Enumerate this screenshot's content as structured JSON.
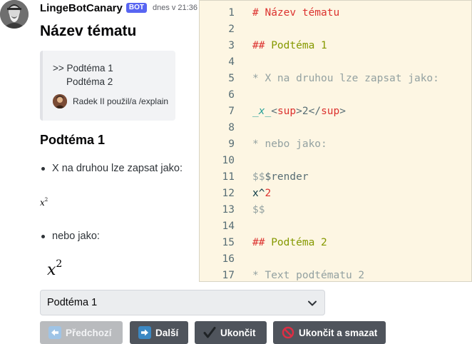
{
  "message": {
    "author": "LingeBotCanary",
    "bot_tag": "BOT",
    "timestamp": "dnes v 21:36"
  },
  "embed": {
    "title": "Název tématu",
    "reply": {
      "line1": ">> Podtéma 1",
      "line2": "Podtéma 2",
      "user_text": "Radek II použil/a /explain"
    },
    "section_heading": "Podtéma 1",
    "bullets": [
      "X na druhou lze zapsat jako:",
      "nebo jako:"
    ],
    "math_inline": {
      "base": "x",
      "exp": "2"
    },
    "math_rendered": {
      "base": "x",
      "exp": "2"
    }
  },
  "code_panel": {
    "lines": [
      {
        "n": "1",
        "parts": [
          {
            "t": "# Název tématu",
            "c": "c-heading"
          }
        ]
      },
      {
        "n": "2",
        "parts": []
      },
      {
        "n": "3",
        "parts": [
          {
            "t": "## ",
            "c": "c-heading"
          },
          {
            "t": "Podtéma 1",
            "c": "c-heading2"
          }
        ]
      },
      {
        "n": "4",
        "parts": []
      },
      {
        "n": "5",
        "parts": [
          {
            "t": "* X na druhou lze zapsat jako:",
            "c": "c-gray"
          }
        ]
      },
      {
        "n": "6",
        "parts": []
      },
      {
        "n": "7",
        "parts": [
          {
            "t": "_x_",
            "c": "c-italic"
          },
          {
            "t": "<",
            "c": "c-plain"
          },
          {
            "t": "sup",
            "c": "c-tag"
          },
          {
            "t": ">2</",
            "c": "c-plain"
          },
          {
            "t": "sup",
            "c": "c-tag"
          },
          {
            "t": ">",
            "c": "c-plain"
          }
        ]
      },
      {
        "n": "8",
        "parts": []
      },
      {
        "n": "9",
        "parts": [
          {
            "t": "* nebo jako:",
            "c": "c-gray"
          }
        ]
      },
      {
        "n": "10",
        "parts": []
      },
      {
        "n": "11",
        "parts": [
          {
            "t": "$$",
            "c": "c-gray"
          },
          {
            "t": "$render",
            "c": "c-plain"
          }
        ]
      },
      {
        "n": "12",
        "parts": [
          {
            "t": "x^",
            "c": "c-dark"
          },
          {
            "t": "2",
            "c": "c-tag"
          }
        ]
      },
      {
        "n": "13",
        "parts": [
          {
            "t": "$$",
            "c": "c-gray"
          }
        ]
      },
      {
        "n": "14",
        "parts": []
      },
      {
        "n": "15",
        "parts": [
          {
            "t": "## ",
            "c": "c-heading"
          },
          {
            "t": "Podtéma 2",
            "c": "c-heading2"
          }
        ]
      },
      {
        "n": "16",
        "parts": []
      },
      {
        "n": "17",
        "parts": [
          {
            "t": "* Text podtématu 2",
            "c": "c-gray"
          }
        ]
      }
    ]
  },
  "select": {
    "value": "Podtéma 1"
  },
  "buttons": {
    "prev": "Předchozí",
    "next": "Další",
    "finish": "Ukončit",
    "finish_delete": "Ukončit a smazat"
  },
  "colors": {
    "accent": "#5865f2",
    "code_background": "#fdf6e3",
    "button_gray": "#4f545c",
    "button_disabled": "#b9bbbe",
    "arrow_blue": "#3b88c3",
    "prohibited_red": "#dd2e44"
  },
  "icons": {
    "prev": "arrow-left-icon",
    "next": "arrow-right-icon",
    "finish": "check-mark-icon",
    "finish_delete": "prohibited-icon",
    "select": "chevron-down-icon"
  }
}
